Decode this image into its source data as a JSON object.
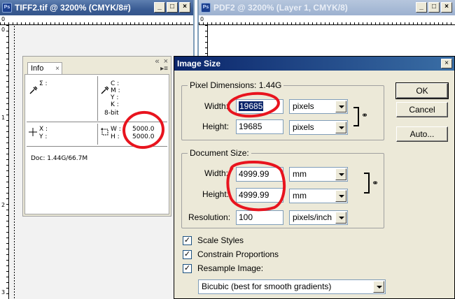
{
  "doc1": {
    "title": "TIFF2.tif @ 3200% (CMYK/8#)",
    "app_icon": "Ps",
    "ruler_top_label": "0",
    "ruler_left_labels": [
      "0",
      "1",
      "2",
      "3"
    ],
    "buttons": [
      "minimize",
      "maximize",
      "close"
    ]
  },
  "doc2": {
    "title": "PDF2 @ 3200% (Layer 1, CMYK/8)",
    "app_icon": "Ps",
    "ruler_top_label": "0",
    "buttons": [
      "minimize",
      "maximize",
      "close"
    ]
  },
  "info_palette": {
    "tab_label": "Info",
    "tab_close": "×",
    "pal_minimize": "«",
    "pal_close": "×",
    "menu_icon": "▸≡",
    "sigma_label": "Σ :",
    "cmyk_labels": [
      "C :",
      "M :",
      "Y :",
      "K :"
    ],
    "bit_depth": "8-bit",
    "xy_labels": [
      "X :",
      "Y :"
    ],
    "wh_labels": [
      "W :",
      "H :"
    ],
    "width_value": "5000.0",
    "height_value": "5000.0",
    "doc_size": "Doc: 1.44G/66.7M"
  },
  "dialog": {
    "title": "Image Size",
    "close": "×",
    "pixel_dimensions": {
      "label": "Pixel Dimensions:  1.44G",
      "width_label": "Width:",
      "width_value": "19685",
      "width_unit": "pixels",
      "height_label": "Height:",
      "height_value": "19685",
      "height_unit": "pixels"
    },
    "document_size": {
      "label": "Document Size:",
      "width_label": "Width:",
      "width_value": "4999.99",
      "width_unit": "mm",
      "height_label": "Height:",
      "height_value": "4999.99",
      "height_unit": "mm",
      "resolution_label": "Resolution:",
      "resolution_value": "100",
      "resolution_unit": "pixels/inch"
    },
    "checkboxes": [
      {
        "label": "Scale Styles",
        "checked": true
      },
      {
        "label": "Constrain Proportions",
        "checked": true
      },
      {
        "label": "Resample Image:",
        "checked": true
      }
    ],
    "resample_method": "Bicubic (best for smooth gradients)",
    "buttons": {
      "ok": "OK",
      "cancel": "Cancel",
      "auto": "Auto..."
    }
  },
  "colors": {
    "annotation": "#e8141e",
    "title_active": "#0a246a",
    "selection": "#0a246a"
  }
}
